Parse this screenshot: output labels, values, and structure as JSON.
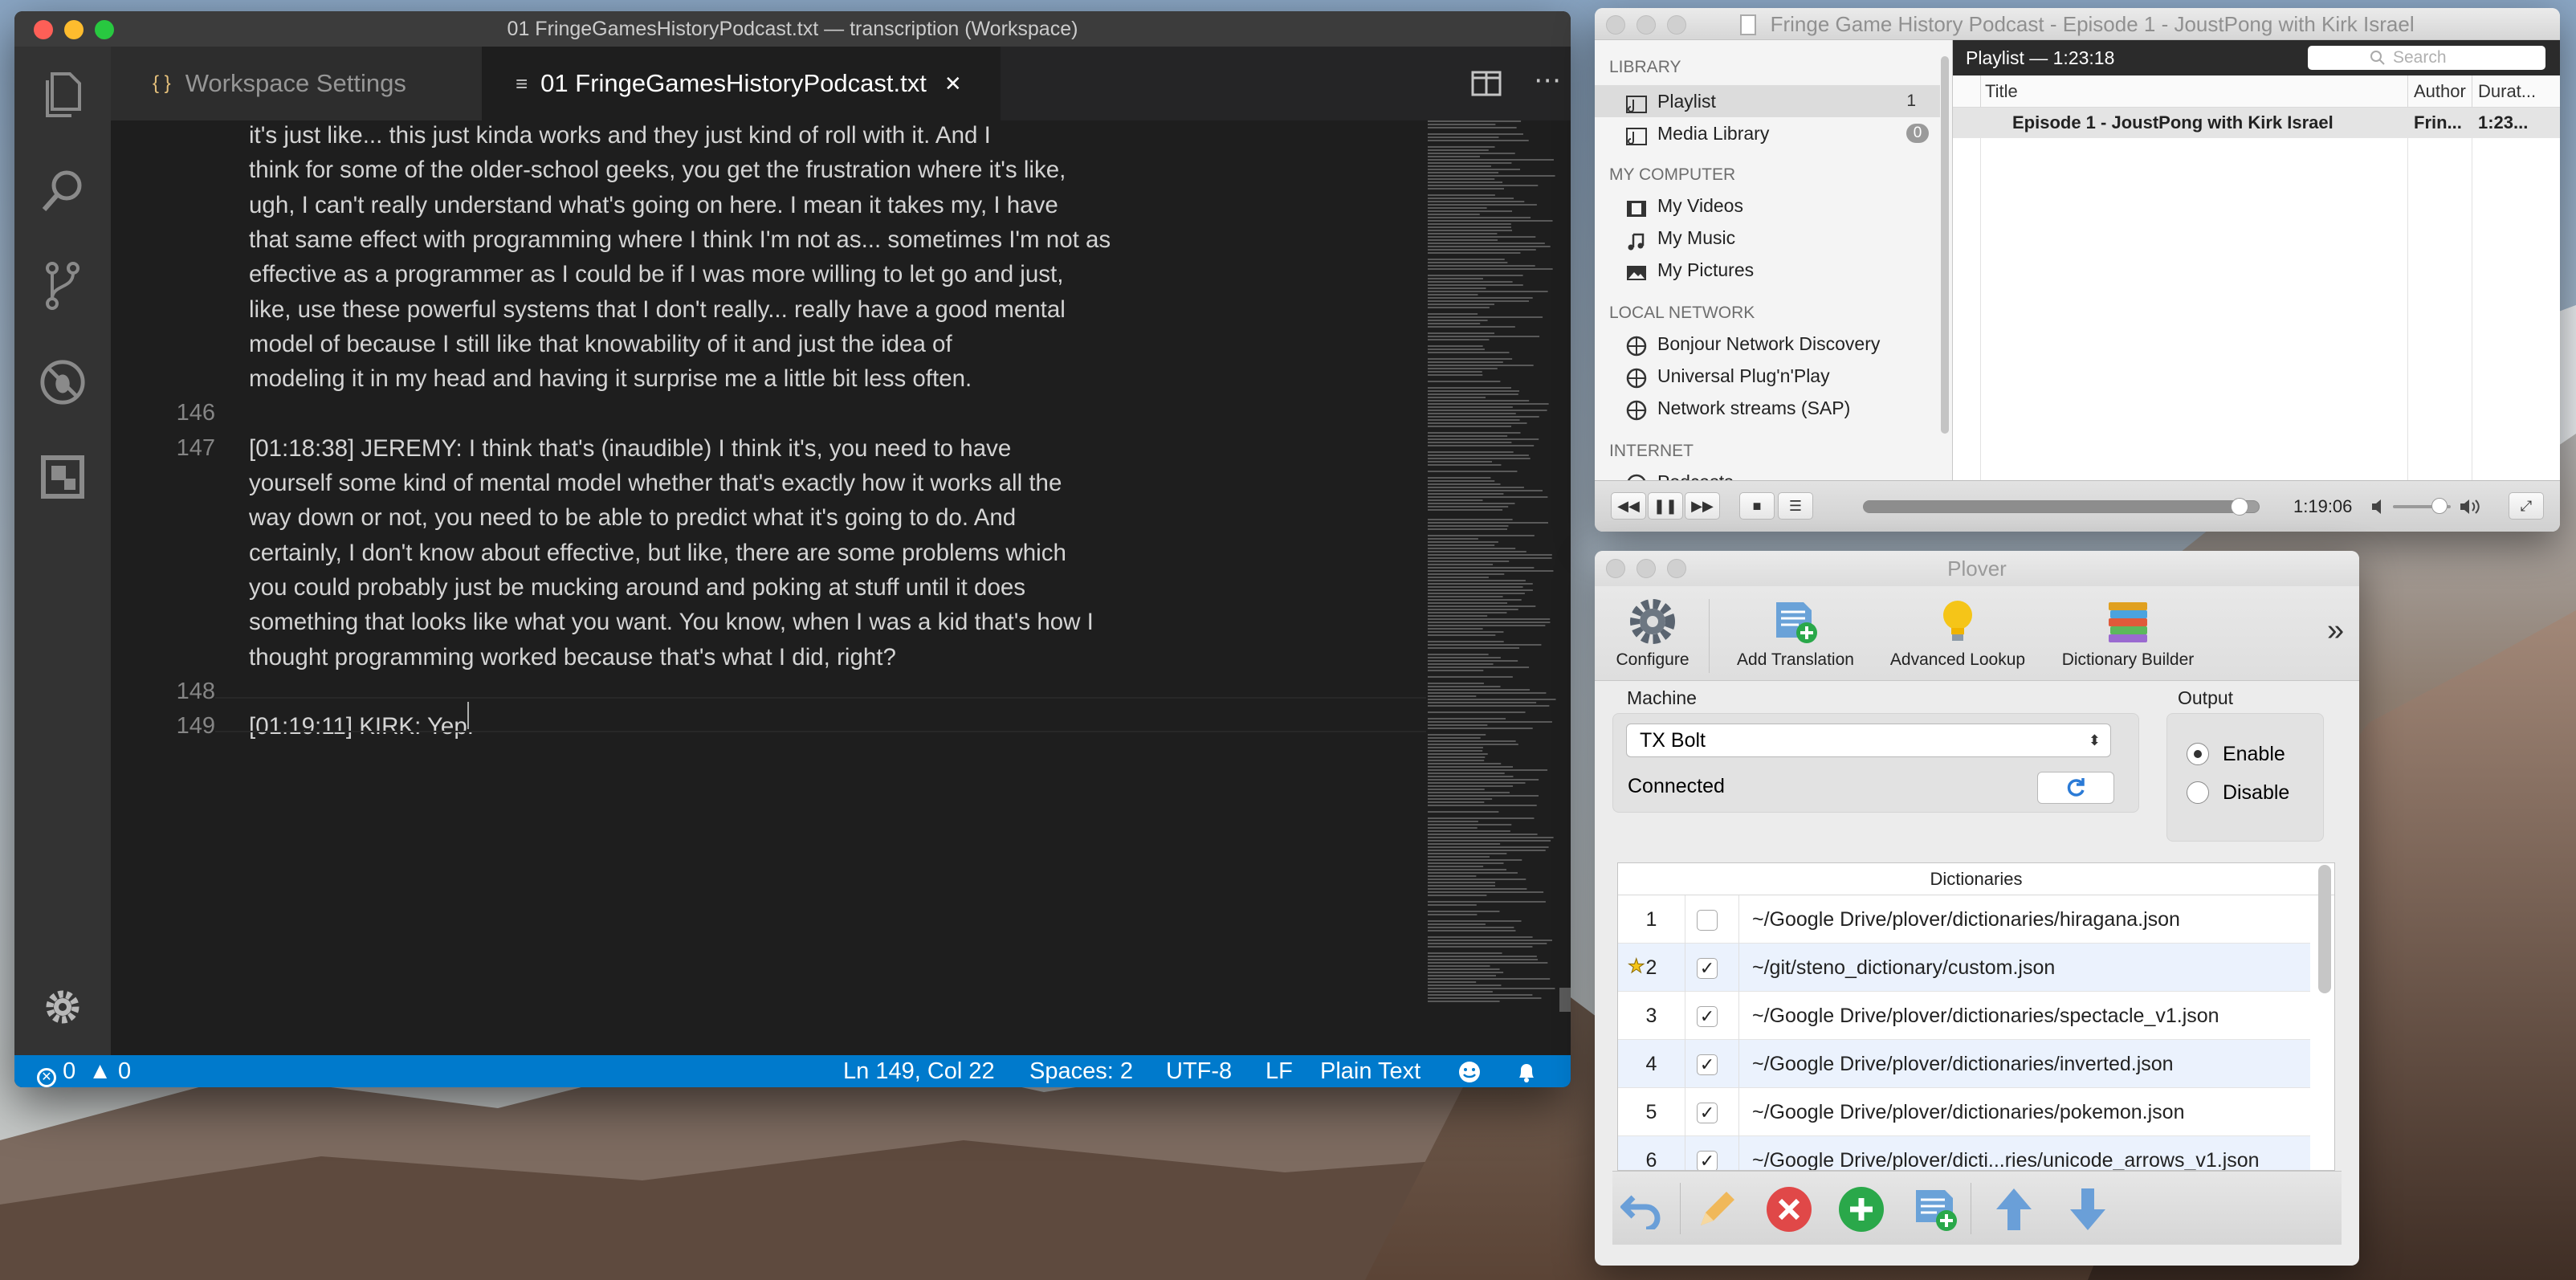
{
  "vscode": {
    "window_title": "01 FringeGamesHistoryPodcast.txt — transcription (Workspace)",
    "tabs": [
      {
        "icon": "{ }",
        "label": "Workspace Settings"
      },
      {
        "icon": "≡",
        "label": "01 FringeGamesHistoryPodcast.txt",
        "close": "✕"
      }
    ],
    "editor_lines": [
      {
        "num": "",
        "text": "it's just like... this just kinda works and they just kind of roll with it. And I"
      },
      {
        "num": "",
        "text": "think for some of the older-school geeks, you get the frustration where it's like,"
      },
      {
        "num": "",
        "text": " ugh, I can't really understand what's going on here. I mean it takes my, I have"
      },
      {
        "num": "",
        "text": "that same effect with programming where I think I'm not as... sometimes I'm not as"
      },
      {
        "num": "",
        "text": "effective as a programmer as I could be if I was more willing to let go and just,"
      },
      {
        "num": "",
        "text": "like, use these powerful systems that I don't really... really have a good mental"
      },
      {
        "num": "",
        "text": "model of because I still like that knowability of it and just the idea of"
      },
      {
        "num": "",
        "text": "modeling it in my head and having it surprise me a little bit less often."
      },
      {
        "num": "146",
        "text": ""
      },
      {
        "num": "147",
        "text": "[01:18:38] JEREMY: I think that's (inaudible) I think it's, you need to have"
      },
      {
        "num": "",
        "text": "yourself some kind of mental model whether that's exactly how it works all the"
      },
      {
        "num": "",
        "text": "way down or not, you need to be able to predict what it's going to do. And"
      },
      {
        "num": "",
        "text": "certainly, I don't know about effective, but like, there are some problems which"
      },
      {
        "num": "",
        "text": "you could probably just be mucking around and poking at stuff until it does"
      },
      {
        "num": "",
        "text": "something that looks like what you want. You know, when I was a kid that's how I"
      },
      {
        "num": "",
        "text": "thought programming worked because that's what I did, right?"
      },
      {
        "num": "148",
        "text": ""
      },
      {
        "num": "149",
        "text": "[01:19:11] KIRK: Yep."
      }
    ],
    "status": {
      "errors": "0",
      "warnings": "0",
      "position": "Ln 149, Col 22",
      "spaces": "Spaces: 2",
      "encoding": "UTF-8",
      "eol": "LF",
      "language": "Plain Text"
    }
  },
  "vlc": {
    "window_title": "Fringe Game History Podcast - Episode 1 - JoustPong with Kirk Israel",
    "sections": {
      "library": "LIBRARY",
      "my_computer": "MY COMPUTER",
      "local_network": "LOCAL NETWORK",
      "internet": "INTERNET"
    },
    "library_items": [
      {
        "label": "Playlist",
        "count": "1"
      },
      {
        "label": "Media Library",
        "count": "0"
      }
    ],
    "computer_items": [
      "My Videos",
      "My Music",
      "My Pictures"
    ],
    "network_items": [
      "Bonjour Network Discovery",
      "Universal Plug'n'Play",
      "Network streams (SAP)"
    ],
    "internet_items": [
      "Podcasts"
    ],
    "playlist_header": "Playlist — 1:23:18",
    "search_placeholder": "Search",
    "columns": {
      "title": "Title",
      "author": "Author",
      "duration": "Durat..."
    },
    "row": {
      "title": "Episode 1 - JoustPong with Kirk Israel",
      "author": "Frin...",
      "duration": "1:23..."
    },
    "elapsed": "1:19:06",
    "progress": 0.953,
    "volume": 0.8
  },
  "plover": {
    "window_title": "Plover",
    "toolbar": [
      "Configure",
      "Add Translation",
      "Advanced Lookup",
      "Dictionary Builder"
    ],
    "more": "»",
    "machine_label": "Machine",
    "machine_value": "TX Bolt",
    "connection_status": "Connected",
    "output_label": "Output",
    "output_enable": "Enable",
    "output_disable": "Disable",
    "dictionaries_header": "Dictionaries",
    "dictionaries": [
      {
        "num": "1",
        "checked": false,
        "star": false,
        "path": "~/Google Drive/plover/dictionaries/hiragana.json"
      },
      {
        "num": "2",
        "checked": true,
        "star": true,
        "path": "~/git/steno_dictionary/custom.json"
      },
      {
        "num": "3",
        "checked": true,
        "star": false,
        "path": "~/Google Drive/plover/dictionaries/spectacle_v1.json"
      },
      {
        "num": "4",
        "checked": true,
        "star": false,
        "path": "~/Google Drive/plover/dictionaries/inverted.json"
      },
      {
        "num": "5",
        "checked": true,
        "star": false,
        "path": "~/Google Drive/plover/dictionaries/pokemon.json"
      },
      {
        "num": "6",
        "checked": true,
        "star": false,
        "path": "~/Google Drive/plover/dicti...ries/unicode_arrows_v1.json"
      }
    ]
  },
  "colors": {
    "vscode_bg": "#1e1e1e",
    "status_bar": "#007acc",
    "plover_selection": "#ebf2fd",
    "add_green": "#2aa84a",
    "remove_red": "#e04848"
  }
}
